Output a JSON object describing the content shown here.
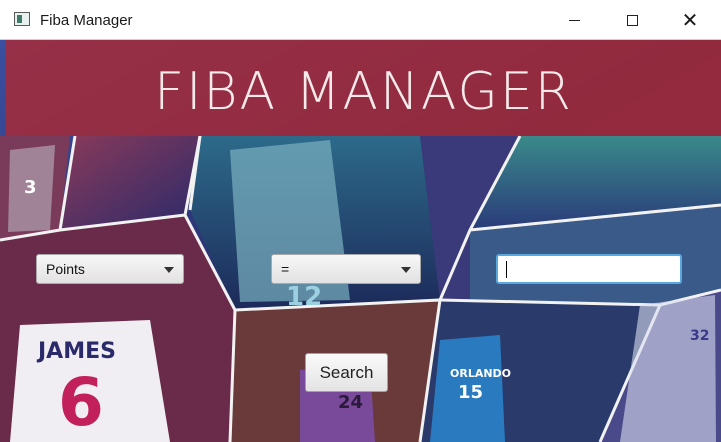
{
  "window": {
    "title": "Fiba Manager"
  },
  "banner": {
    "title": "FIBA MANAGER"
  },
  "filters": {
    "field_value": "Points",
    "operator_value": "=",
    "query_value": ""
  },
  "actions": {
    "search_label": "Search"
  },
  "background": {
    "jersey_name": "JAMES",
    "jersey_number": "6",
    "jersey2_name": "ORLANDO",
    "jersey2_number": "15",
    "jersey3_number": "24",
    "jersey4_number": "3",
    "jersey5_number": "12",
    "jersey6_number": "32"
  },
  "colors": {
    "banner": "#aa2a34",
    "focus": "#5aa8e0"
  }
}
